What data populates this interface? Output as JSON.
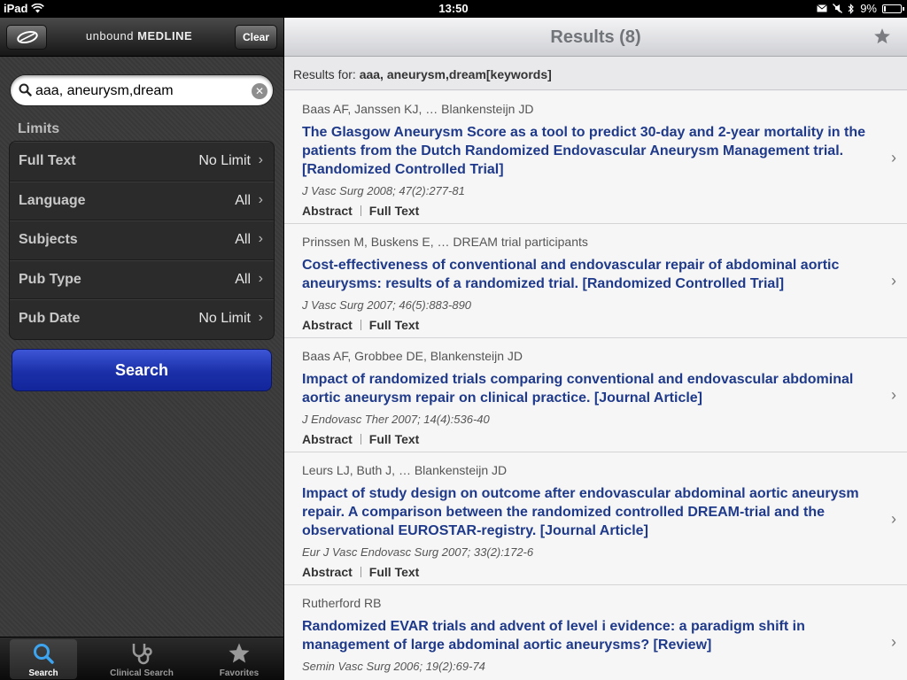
{
  "status": {
    "device": "iPad",
    "time": "13:50",
    "battery": "9%",
    "battery_level": 0.09
  },
  "sidebar": {
    "app_title_light": "unbound",
    "app_title_bold": "MEDLINE",
    "clear_label": "Clear",
    "search_value": "aaa, aneurysm,dream",
    "limits_label": "Limits",
    "limits": [
      {
        "name": "Full Text",
        "value": "No Limit"
      },
      {
        "name": "Language",
        "value": "All"
      },
      {
        "name": "Subjects",
        "value": "All"
      },
      {
        "name": "Pub Type",
        "value": "All"
      },
      {
        "name": "Pub Date",
        "value": "No Limit"
      }
    ],
    "search_button": "Search"
  },
  "tabbar": {
    "tabs": [
      {
        "label": "Search",
        "icon": "search-icon",
        "active": true
      },
      {
        "label": "Clinical Search",
        "icon": "stethoscope-icon",
        "active": false
      },
      {
        "label": "Favorites",
        "icon": "star-icon",
        "active": false
      }
    ]
  },
  "main": {
    "title": "Results (8)",
    "results_for_prefix": "Results for:",
    "results_for_query": "aaa, aneurysm,dream[keywords]",
    "abstract_label": "Abstract",
    "fulltext_label": "Full Text",
    "results": [
      {
        "authors": "Baas AF, Janssen KJ, … Blankensteijn JD",
        "title": "The Glasgow Aneurysm Score as a tool to predict 30-day and 2-year mortality in the patients from the Dutch Randomized Endovascular Aneurysm Management trial. [Randomized Controlled Trial]",
        "citation": "J Vasc Surg 2008; 47(2):277-81"
      },
      {
        "authors": "Prinssen M, Buskens E, … DREAM trial participants",
        "title": "Cost-effectiveness of conventional and endovascular repair of abdominal aortic aneurysms: results of a randomized trial. [Randomized Controlled Trial]",
        "citation": "J Vasc Surg 2007; 46(5):883-890"
      },
      {
        "authors": "Baas AF, Grobbee DE, Blankensteijn JD",
        "title": "Impact of randomized trials comparing conventional and endovascular abdominal aortic aneurysm repair on clinical practice. [Journal Article]",
        "citation": "J Endovasc Ther 2007; 14(4):536-40"
      },
      {
        "authors": "Leurs LJ, Buth J, … Blankensteijn JD",
        "title": "Impact of study design on outcome after endovascular abdominal aortic aneurysm repair. A comparison between the randomized controlled DREAM-trial and the observational EUROSTAR-registry. [Journal Article]",
        "citation": "Eur J Vasc Endovasc Surg 2007; 33(2):172-6"
      },
      {
        "authors": "Rutherford RB",
        "title": "Randomized EVAR trials and advent of level i evidence: a paradigm shift in management of large abdominal aortic aneurysms? [Review]",
        "citation": "Semin Vasc Surg 2006; 19(2):69-74"
      }
    ]
  }
}
